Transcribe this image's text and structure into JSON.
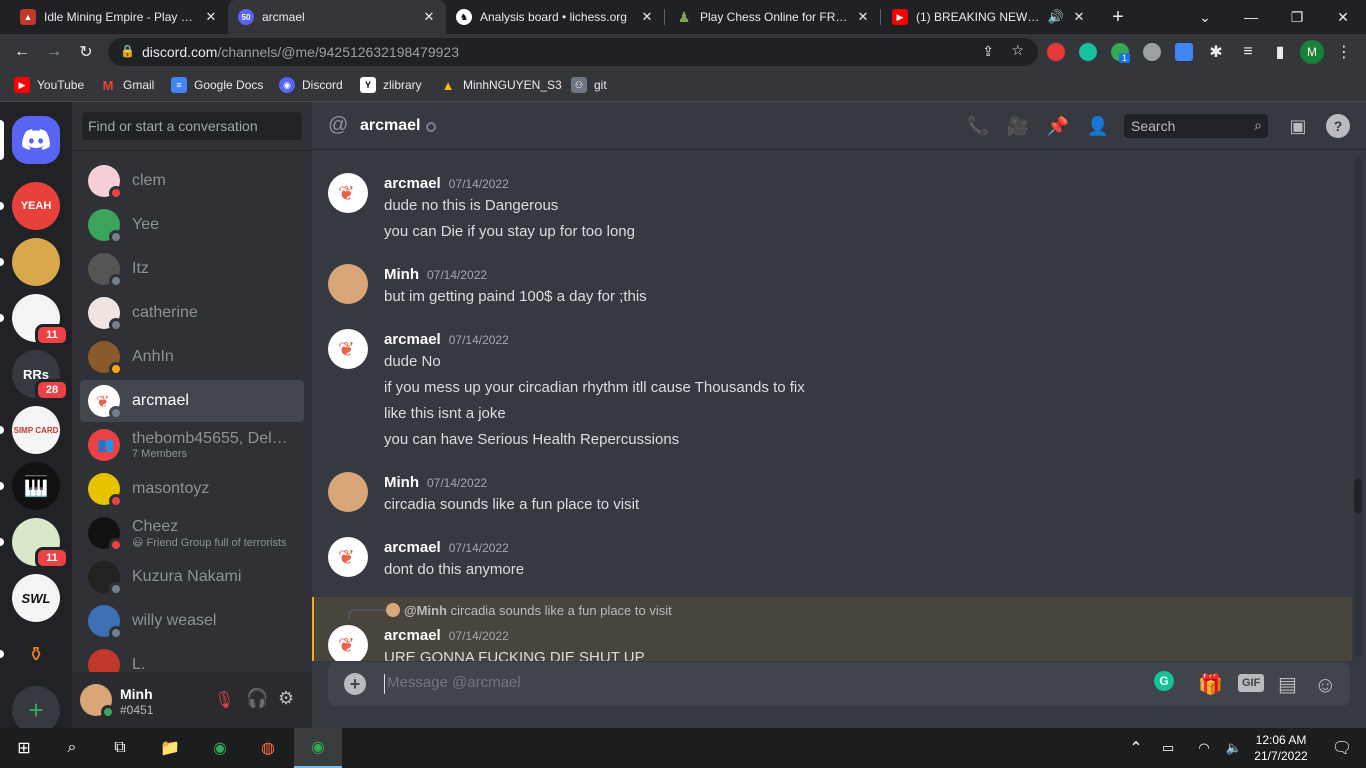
{
  "browser": {
    "tabs": [
      {
        "title": "Idle Mining Empire - Play Idle",
        "favicon": "idle-mining-favicon",
        "color": "#c0392b"
      },
      {
        "title": "arcmael",
        "favicon": "discord-favicon",
        "badge": "50",
        "color": "#5865f2"
      },
      {
        "title": "Analysis board • lichess.org",
        "favicon": "lichess-favicon",
        "color": "#ffffff"
      },
      {
        "title": "Play Chess Online for FREE w",
        "favicon": "chess-com-favicon",
        "color": "#7fa650"
      },
      {
        "title": "(1) BREAKING NEWS: Ma",
        "favicon": "youtube-favicon",
        "color": "#ff0000"
      }
    ],
    "new_tab": "+",
    "url_domain": "discord.com",
    "url_path": "/channels/@me/942512632198479923",
    "extensions_badge": "1",
    "profile_initial": "M",
    "bookmarks": [
      {
        "label": "YouTube",
        "icon": "youtube-icon",
        "color": "#ff0000"
      },
      {
        "label": "Gmail",
        "icon": "gmail-icon",
        "color": "#ea4335"
      },
      {
        "label": "Google Docs",
        "icon": "docs-icon",
        "color": "#4285f4"
      },
      {
        "label": "Discord",
        "icon": "discord-icon",
        "color": "#5865f2"
      },
      {
        "label": "zlibrary",
        "icon": "zlibrary-icon",
        "color": "#ffffff"
      },
      {
        "label": "MinhNGUYEN_S3",
        "icon": "drive-icon",
        "color": "#fbbc04"
      },
      {
        "label": "git",
        "icon": "github-icon",
        "color": "#9aa0a6"
      }
    ]
  },
  "discord": {
    "guilds": [
      {
        "name": "home",
        "label": ""
      },
      {
        "name": "yeah-server",
        "label": "YEAH",
        "badge": ""
      },
      {
        "name": "gold-server",
        "label": "",
        "badge": ""
      },
      {
        "name": "penguin-server",
        "label": "",
        "badge": "11"
      },
      {
        "name": "rrs-server",
        "label": "RRs",
        "badge": "28"
      },
      {
        "name": "simp-card-server",
        "label": "SIMP CARD",
        "badge": ""
      },
      {
        "name": "piano-server",
        "label": "",
        "badge": ""
      },
      {
        "name": "map-server",
        "label": "",
        "badge": "11"
      },
      {
        "name": "swl-server",
        "label": "SWL",
        "badge": ""
      },
      {
        "name": "totem-server",
        "label": "",
        "badge": ""
      }
    ],
    "add_server": "+",
    "dm_search_placeholder": "Find or start a conversation",
    "dms": [
      {
        "name": "clem",
        "sub": "",
        "status": "dnd",
        "avatar_color": "#f5d0d6"
      },
      {
        "name": "Yee",
        "sub": "",
        "status": "offline",
        "avatar_color": "#3ba55c"
      },
      {
        "name": "Itz",
        "sub": "",
        "status": "offline",
        "avatar_color": "#555"
      },
      {
        "name": "catherine",
        "sub": "",
        "status": "offline",
        "avatar_color": "#f0e3e0"
      },
      {
        "name": "AnhIn",
        "sub": "",
        "status": "idle",
        "avatar_color": "#8b5a2b"
      },
      {
        "name": "arcmael",
        "sub": "",
        "status": "offline",
        "avatar_color": "#ffffff",
        "selected": true
      },
      {
        "name": "thebomb45655, Delet...",
        "sub": "7 Members",
        "status": "",
        "avatar_color": "#ed4245"
      },
      {
        "name": "masontoyz",
        "sub": "",
        "status": "dnd",
        "avatar_color": "#e6c200"
      },
      {
        "name": "Cheez",
        "sub": "😃 Friend Group full of terrorists",
        "status": "dnd",
        "avatar_color": "#111"
      },
      {
        "name": "Kuzura Nakami",
        "sub": "",
        "status": "offline",
        "avatar_color": "#222"
      },
      {
        "name": "willy weasel",
        "sub": "",
        "status": "offline",
        "avatar_color": "#3d6fb5"
      },
      {
        "name": "L.",
        "sub": "",
        "status": "",
        "avatar_color": "#c0392b"
      }
    ],
    "user": {
      "name": "Minh",
      "tag": "#0451"
    },
    "channel": {
      "name": "arcmael",
      "search": "Search"
    },
    "messages": [
      {
        "author": "arcmael",
        "time": "07/14/2022",
        "lines": [
          "dude no this is Dangerous",
          "you can Die if you stay up for too long"
        ]
      },
      {
        "author": "Minh",
        "time": "07/14/2022",
        "lines": [
          "but im getting paind 100$ a day for ;this"
        ]
      },
      {
        "author": "arcmael",
        "time": "07/14/2022",
        "lines": [
          "dude No",
          "if you mess up your circadian rhythm itll cause Thousands to fix",
          "like this isnt a joke",
          "you can have Serious Health Repercussions"
        ]
      },
      {
        "author": "Minh",
        "time": "07/14/2022",
        "lines": [
          "circadia sounds like a fun place to visit"
        ]
      },
      {
        "author": "arcmael",
        "time": "07/14/2022",
        "lines": [
          "dont do this anymore"
        ]
      },
      {
        "author": "arcmael",
        "time": "07/14/2022",
        "reply_to": "@Minh",
        "reply_text": "circadia sounds like a fun place to visit",
        "lines": [
          "URE GONNA FUCKING DIE SHUT UP"
        ]
      }
    ],
    "composer_placeholder": "Message @arcmael",
    "gif_label": "GIF"
  },
  "taskbar": {
    "time": "12:06 AM",
    "date": "21/7/2022"
  }
}
